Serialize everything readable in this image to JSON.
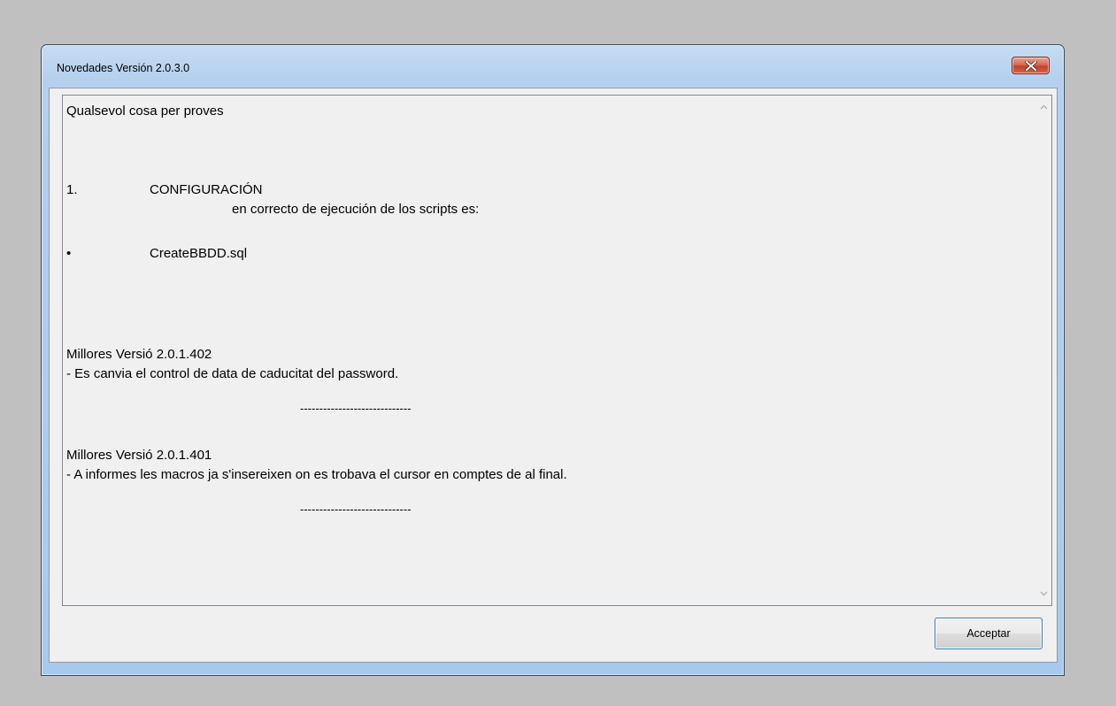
{
  "window": {
    "title": "Novedades Versión 2.0.3.0",
    "close_icon": "close-icon"
  },
  "content": {
    "lines": [
      "Qualsevol cosa per proves",
      "1.",
      "CONFIGURACIÓN",
      "en correcto de ejecución de los scripts es:",
      "•",
      "CreateBBDD.sql",
      "Millores Versió 2.0.1.402",
      "- Es canvia el control de data de caducitat del password.",
      "-----------------------------",
      "Millores Versió 2.0.1.401",
      "- A informes les macros ja s'insereixen on es trobava el cursor en comptes de al final.",
      "-----------------------------"
    ]
  },
  "buttons": {
    "accept_label": "Acceptar"
  },
  "colors": {
    "close_button": "#c4412a",
    "title_gradient_top": "#c6dcf2",
    "client_background": "#f0f0f0"
  }
}
